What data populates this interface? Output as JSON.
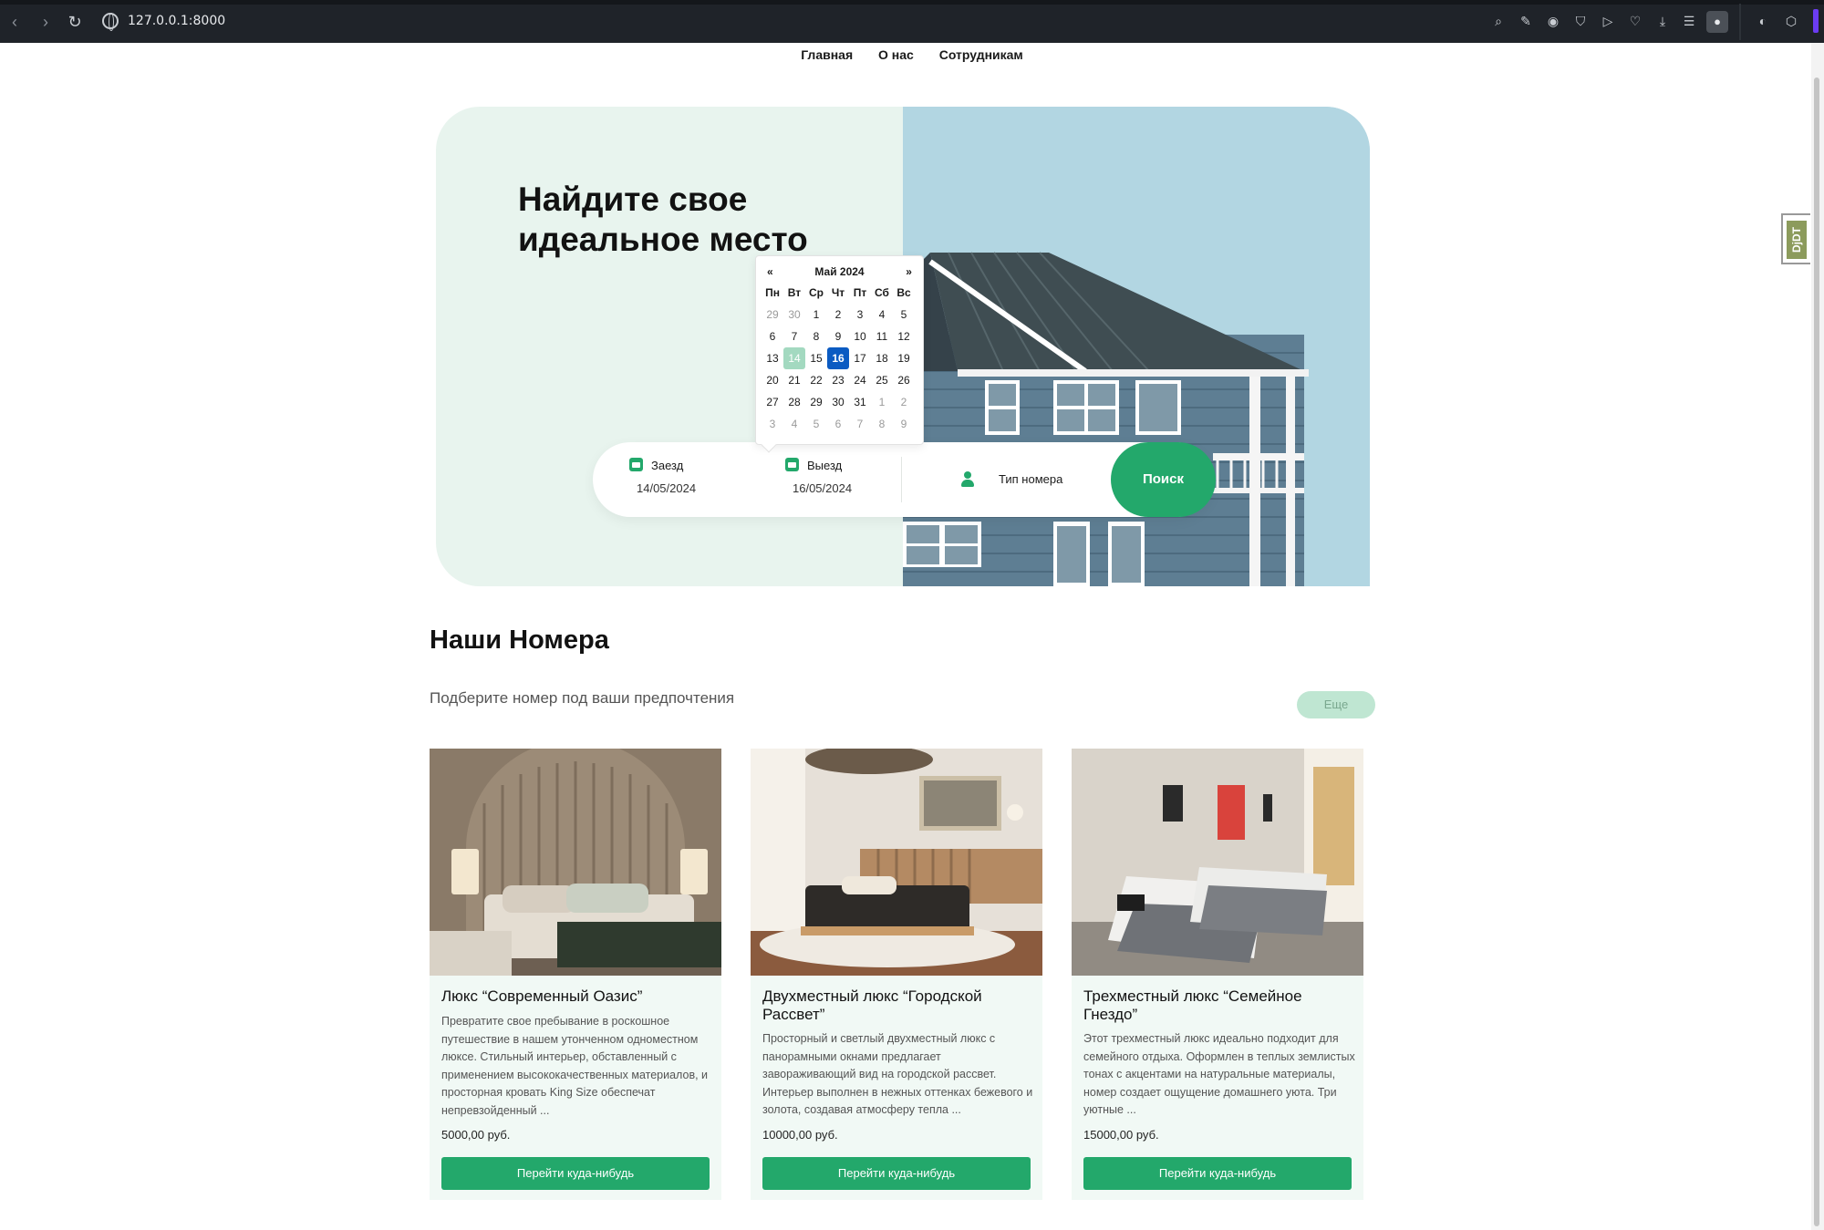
{
  "browser": {
    "url": "127.0.0.1:8000"
  },
  "nav": {
    "items": [
      "Главная",
      "О нас",
      "Сотрудникам"
    ]
  },
  "hero": {
    "title_line1": "Найдите свое",
    "title_line2": "идеальное место"
  },
  "search": {
    "checkin_label": "Заезд",
    "checkin_value": "14/05/2024",
    "checkout_label": "Выезд",
    "checkout_value": "16/05/2024",
    "room_type_placeholder": "Тип номера",
    "search_button": "Поиск"
  },
  "datepicker": {
    "prev": "«",
    "next": "»",
    "month_label": "Май 2024",
    "weekdays": [
      "Пн",
      "Вт",
      "Ср",
      "Чт",
      "Пт",
      "Сб",
      "Вс"
    ],
    "weeks": [
      [
        "29",
        "30",
        "1",
        "2",
        "3",
        "4",
        "5"
      ],
      [
        "6",
        "7",
        "8",
        "9",
        "10",
        "11",
        "12"
      ],
      [
        "13",
        "14",
        "15",
        "16",
        "17",
        "18",
        "19"
      ],
      [
        "20",
        "21",
        "22",
        "23",
        "24",
        "25",
        "26"
      ],
      [
        "27",
        "28",
        "29",
        "30",
        "31",
        "1",
        "2"
      ],
      [
        "3",
        "4",
        "5",
        "6",
        "7",
        "8",
        "9"
      ]
    ],
    "range_start": "14",
    "selected": "16"
  },
  "rooms": {
    "title": "Наши Номера",
    "subtitle": "Подберите номер под ваши предпочтения",
    "more_button": "Еще",
    "cards": [
      {
        "title": "Люкс “Современный Оазис”",
        "description": "Превратите свое пребывание в роскошное путешествие в нашем утонченном одноместном люксе. Стильный интерьер, обставленный с применением высококачественных материалов, и просторная кровать King Size обеспечат непревзойденный ...",
        "price": "5000,00 руб.",
        "button": "Перейти куда-нибудь"
      },
      {
        "title": "Двухместный люкс “Городской Рассвет”",
        "description": "Просторный и светлый двухместный люкс с панорамными окнами предлагает завораживающий вид на городской рассвет. Интерьер выполнен в нежных оттенках бежевого и золота, создавая атмосферу тепла ...",
        "price": "10000,00 руб.",
        "button": "Перейти куда-нибудь"
      },
      {
        "title": "Трехместный люкс “Семейное Гнездо”",
        "description": "Этот трехместный люкс идеально подходит для семейного отдыха. Оформлен в теплых землистых тонах с акцентами на натуральные материалы, номер создает ощущение домашнего уюта. Три уютные ...",
        "price": "15000,00 руб.",
        "button": "Перейти куда-нибудь"
      }
    ]
  },
  "debug_toolbar": {
    "label": "DjDT"
  },
  "colors": {
    "accent": "#23a86b",
    "hero_bg": "#e8f4ee",
    "selected_day": "#0b5bc2"
  }
}
